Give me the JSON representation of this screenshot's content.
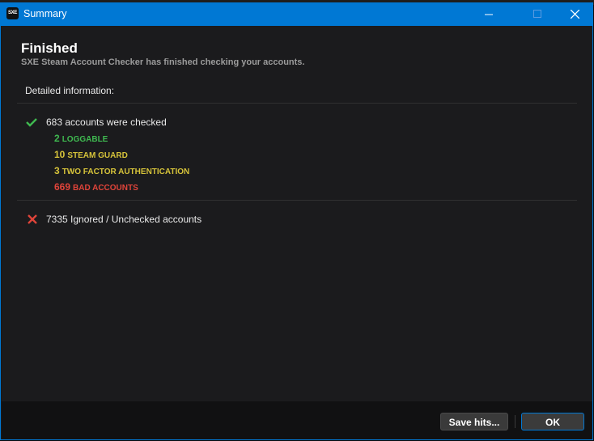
{
  "window": {
    "title": "Summary",
    "app_icon_text": "SXE"
  },
  "summary": {
    "heading": "Finished",
    "subheading": "SXE Steam Account Checker has finished checking your accounts.",
    "detail_label": "Detailed information:"
  },
  "checked": {
    "text": "683 accounts were checked",
    "stats": [
      {
        "count": "2",
        "label": "LOGGABLE",
        "color": "#3fb950"
      },
      {
        "count": "10",
        "label": "STEAM GUARD",
        "color": "#d6c33a"
      },
      {
        "count": "3",
        "label": "TWO FACTOR AUTHENTICATION",
        "color": "#d6c33a"
      },
      {
        "count": "669",
        "label": "BAD ACCOUNTS",
        "color": "#e0443a"
      }
    ]
  },
  "ignored": {
    "text": "7335 Ignored / Unchecked accounts"
  },
  "buttons": {
    "save_label": "Save hits...",
    "ok_label": "OK"
  },
  "icons": {
    "checked": "checkmark-icon",
    "ignored": "x-icon"
  },
  "colors": {
    "accent": "#0078d4",
    "success": "#3fb950",
    "warning": "#d6c33a",
    "error": "#e0443a"
  }
}
